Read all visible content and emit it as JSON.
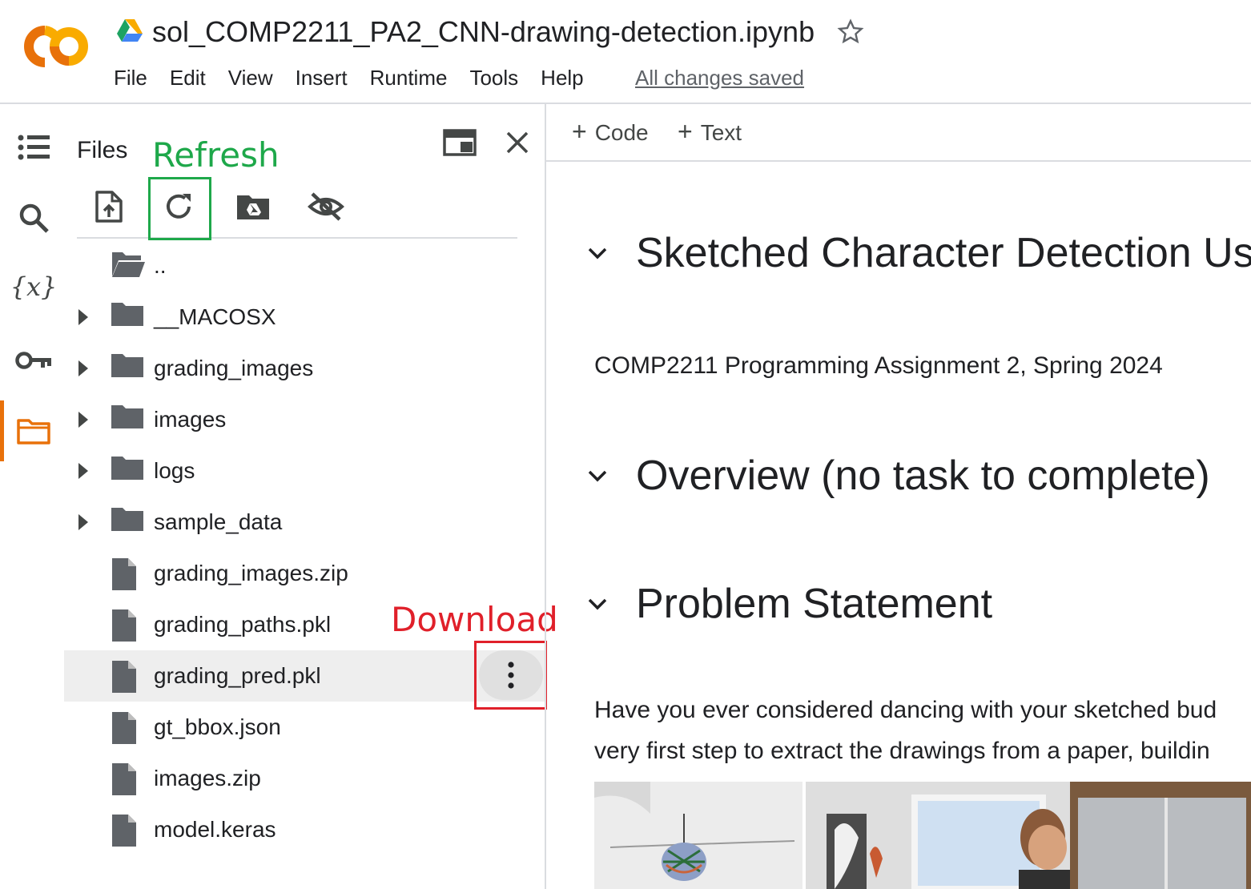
{
  "header": {
    "title": "sol_COMP2211_PA2_CNN-drawing-detection.ipynb",
    "menu": [
      "File",
      "Edit",
      "View",
      "Insert",
      "Runtime",
      "Tools",
      "Help"
    ],
    "save_status": "All changes saved"
  },
  "files_panel": {
    "title": "Files",
    "tree": [
      {
        "name": "..",
        "type": "parent-folder"
      },
      {
        "name": "__MACOSX",
        "type": "folder"
      },
      {
        "name": "grading_images",
        "type": "folder"
      },
      {
        "name": "images",
        "type": "folder"
      },
      {
        "name": "logs",
        "type": "folder"
      },
      {
        "name": "sample_data",
        "type": "folder"
      },
      {
        "name": "grading_images.zip",
        "type": "file"
      },
      {
        "name": "grading_paths.pkl",
        "type": "file"
      },
      {
        "name": "grading_pred.pkl",
        "type": "file",
        "selected": true
      },
      {
        "name": "gt_bbox.json",
        "type": "file"
      },
      {
        "name": "images.zip",
        "type": "file"
      },
      {
        "name": "model.keras",
        "type": "file"
      }
    ]
  },
  "annotations": {
    "refresh": "Refresh",
    "download": "Download"
  },
  "notebook": {
    "toolbar": {
      "add_code": "Code",
      "add_text": "Text"
    },
    "sections": [
      "Sketched Character Detection Usi",
      "Overview (no task to complete)",
      "Problem Statement"
    ],
    "subtitle": "COMP2211 Programming Assignment 2, Spring 2024",
    "paragraph_lines": [
      "Have you ever considered dancing with your sketched bud",
      "very first step to extract the drawings from a paper, buildin"
    ]
  },
  "colors": {
    "refresh_annotation": "#1ea84a",
    "download_annotation": "#e0202a",
    "colab_orange": "#f9ab00",
    "active_rail": "#e8710a"
  }
}
